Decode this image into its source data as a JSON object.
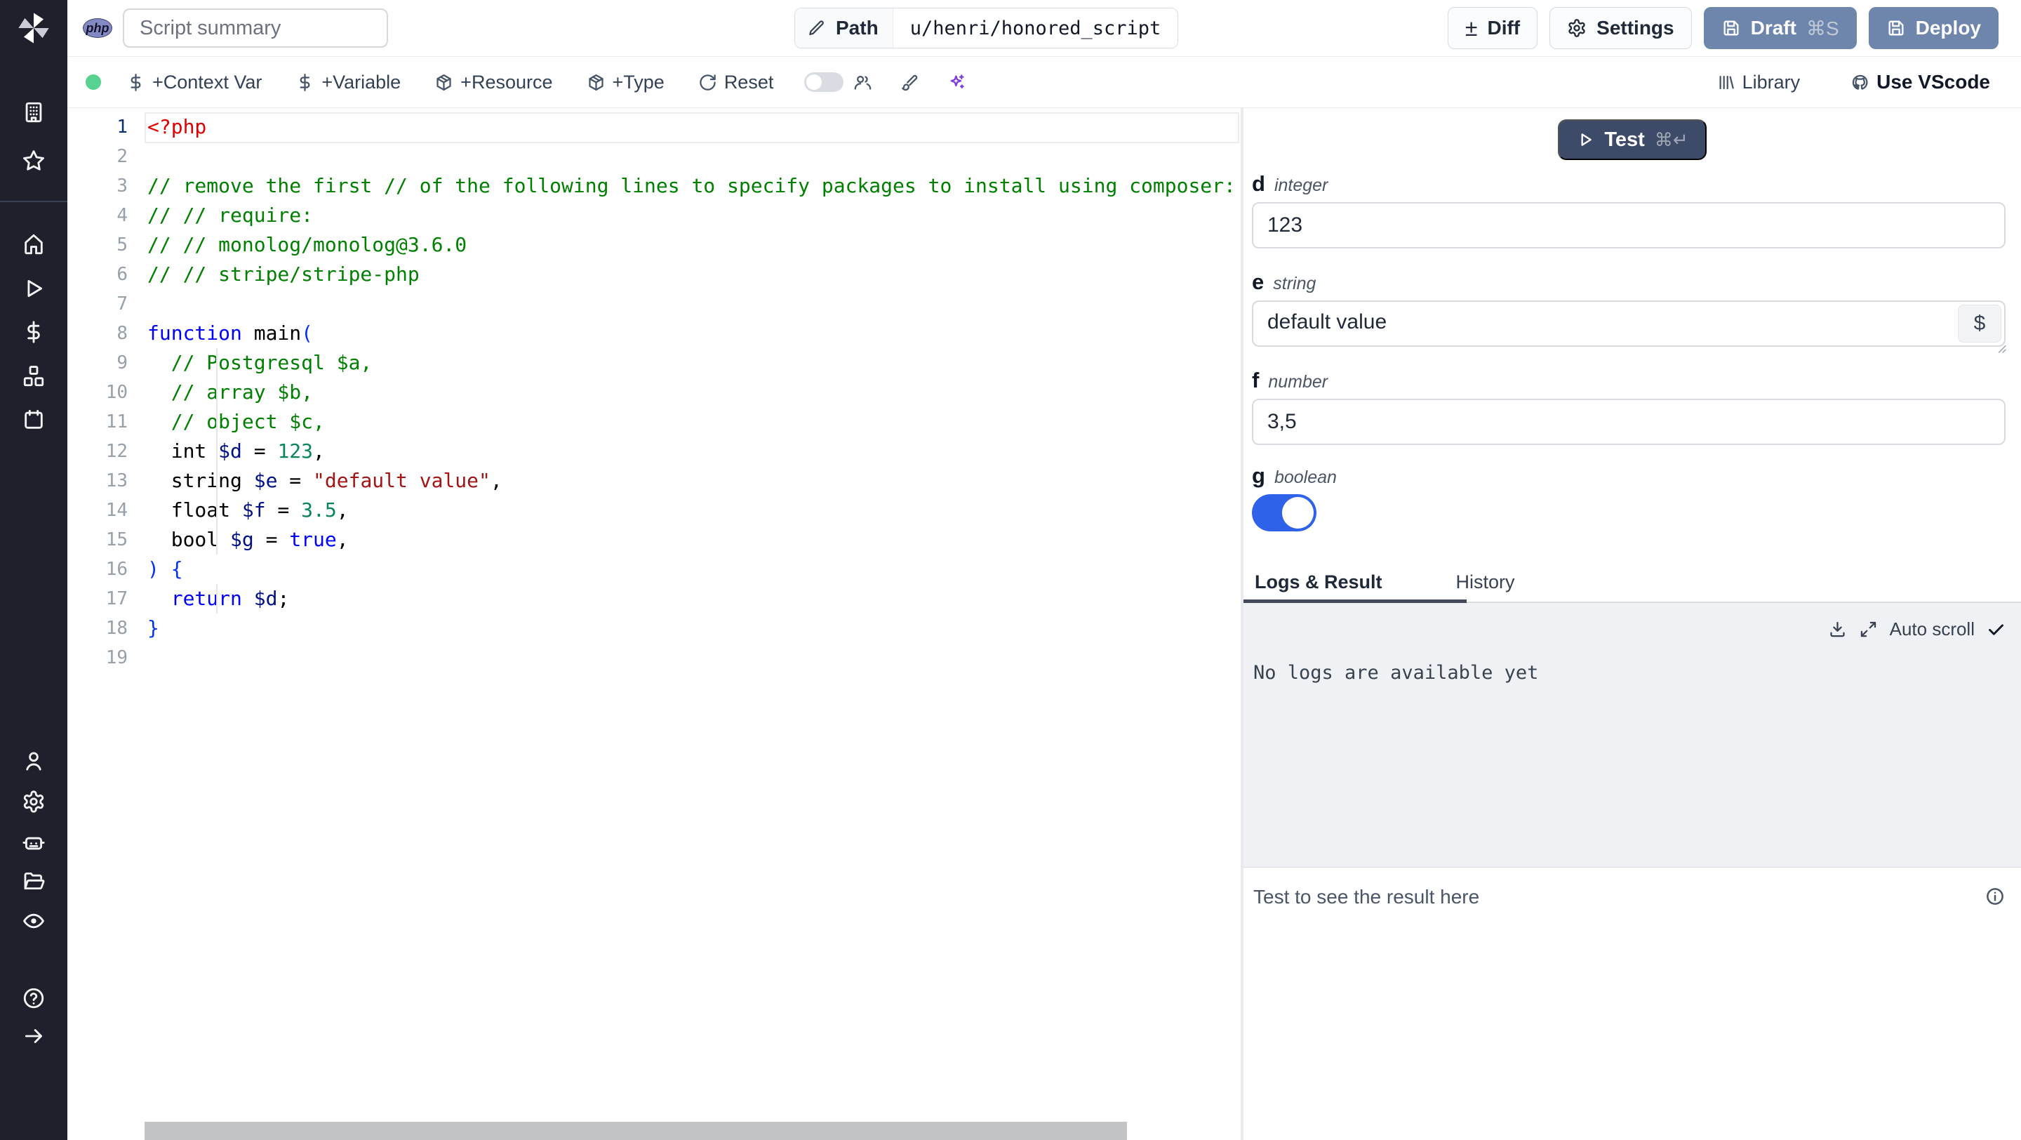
{
  "topbar": {
    "language_badge": "php",
    "summary_placeholder": "Script summary",
    "path_icon": "pencil-icon",
    "path_label": "Path",
    "path_value": "u/henri/honored_script",
    "diff_label": "Diff",
    "settings_label": "Settings",
    "draft_label": "Draft",
    "draft_shortcut": "⌘S",
    "deploy_label": "Deploy"
  },
  "toolbar": {
    "context_var_label": "+Context Var",
    "variable_label": "+Variable",
    "resource_label": "+Resource",
    "type_label": "+Type",
    "reset_label": "Reset",
    "library_label": "Library",
    "vscode_label": "Use VScode",
    "icons": [
      "dollar-icon",
      "dollar-icon",
      "package-icon",
      "package-icon",
      "refresh-icon",
      "users-icon",
      "brush-icon",
      "sparkles-icon",
      "library-icon",
      "github-icon"
    ],
    "status_color": "#57d38f",
    "sparkles_color": "#7c3aed"
  },
  "sidebar": {
    "icons": [
      "building-icon",
      "star-icon",
      "divider",
      "home-icon",
      "play-icon",
      "dollar-icon",
      "boxes-icon",
      "calendar-icon",
      "user-icon",
      "settings-icon",
      "bot-icon",
      "folder-open-icon",
      "eye-icon",
      "help-icon",
      "arrow-right-icon"
    ]
  },
  "editor": {
    "active_line": 1,
    "total_lines": 19,
    "lines": [
      {
        "n": 1,
        "tokens": [
          {
            "c": "meta",
            "t": "<?php"
          }
        ]
      },
      {
        "n": 2,
        "tokens": []
      },
      {
        "n": 3,
        "tokens": [
          {
            "c": "cm",
            "t": "// remove the first // of the following lines to specify packages to install using composer:"
          }
        ]
      },
      {
        "n": 4,
        "tokens": [
          {
            "c": "cm",
            "t": "// // require:"
          }
        ]
      },
      {
        "n": 5,
        "tokens": [
          {
            "c": "cm",
            "t": "// // monolog/monolog@3.6.0"
          }
        ]
      },
      {
        "n": 6,
        "tokens": [
          {
            "c": "cm",
            "t": "// // stripe/stripe-php"
          }
        ]
      },
      {
        "n": 7,
        "tokens": []
      },
      {
        "n": 8,
        "tokens": [
          {
            "c": "kw",
            "t": "function"
          },
          {
            "c": "pl",
            "t": " main"
          },
          {
            "c": "br",
            "t": "("
          }
        ]
      },
      {
        "n": 9,
        "tokens": [
          {
            "c": "cm",
            "t": "  // Postgresql $a,"
          }
        ]
      },
      {
        "n": 10,
        "tokens": [
          {
            "c": "cm",
            "t": "  // array $b,"
          }
        ]
      },
      {
        "n": 11,
        "tokens": [
          {
            "c": "cm",
            "t": "  // object $c,"
          }
        ]
      },
      {
        "n": 12,
        "tokens": [
          {
            "c": "pl",
            "t": "  int "
          },
          {
            "c": "var",
            "t": "$d"
          },
          {
            "c": "pl",
            "t": " = "
          },
          {
            "c": "num",
            "t": "123"
          },
          {
            "c": "pl",
            "t": ","
          }
        ]
      },
      {
        "n": 13,
        "tokens": [
          {
            "c": "pl",
            "t": "  string "
          },
          {
            "c": "var",
            "t": "$e"
          },
          {
            "c": "pl",
            "t": " = "
          },
          {
            "c": "str",
            "t": "\"default value\""
          },
          {
            "c": "pl",
            "t": ","
          }
        ]
      },
      {
        "n": 14,
        "tokens": [
          {
            "c": "pl",
            "t": "  float "
          },
          {
            "c": "var",
            "t": "$f"
          },
          {
            "c": "pl",
            "t": " = "
          },
          {
            "c": "num",
            "t": "3.5"
          },
          {
            "c": "pl",
            "t": ","
          }
        ]
      },
      {
        "n": 15,
        "tokens": [
          {
            "c": "pl",
            "t": "  bool "
          },
          {
            "c": "var",
            "t": "$g"
          },
          {
            "c": "pl",
            "t": " = "
          },
          {
            "c": "kw",
            "t": "true"
          },
          {
            "c": "pl",
            "t": ","
          }
        ]
      },
      {
        "n": 16,
        "tokens": [
          {
            "c": "br",
            "t": ") {"
          }
        ]
      },
      {
        "n": 17,
        "tokens": [
          {
            "c": "pl",
            "t": "  "
          },
          {
            "c": "kw",
            "t": "return"
          },
          {
            "c": "pl",
            "t": " "
          },
          {
            "c": "var",
            "t": "$d"
          },
          {
            "c": "pl",
            "t": ";"
          }
        ]
      },
      {
        "n": 18,
        "tokens": [
          {
            "c": "br",
            "t": "}"
          }
        ]
      },
      {
        "n": 19,
        "tokens": []
      }
    ]
  },
  "runner": {
    "test_label": "Test",
    "test_shortcut": "⌘↵",
    "args": [
      {
        "name": "d",
        "type": "integer",
        "value": "123"
      },
      {
        "name": "e",
        "type": "string",
        "value": "default value"
      },
      {
        "name": "f",
        "type": "number",
        "value": "3,5"
      },
      {
        "name": "g",
        "type": "boolean",
        "value": true
      }
    ],
    "tabs": [
      {
        "label": "Logs & Result",
        "active": true
      },
      {
        "label": "History",
        "active": false
      }
    ],
    "autoscroll_label": "Auto scroll",
    "logs_empty_text": "No logs are available yet",
    "result_placeholder": "Test to see the result here"
  },
  "colors": {
    "rail_bg": "#1e212b",
    "primary_button": "#6e86ab",
    "test_button": "#3d4b69",
    "toggle_on": "#2e63e9",
    "php_badge": "#8289c5",
    "logs_bg": "#f0f1f4"
  }
}
